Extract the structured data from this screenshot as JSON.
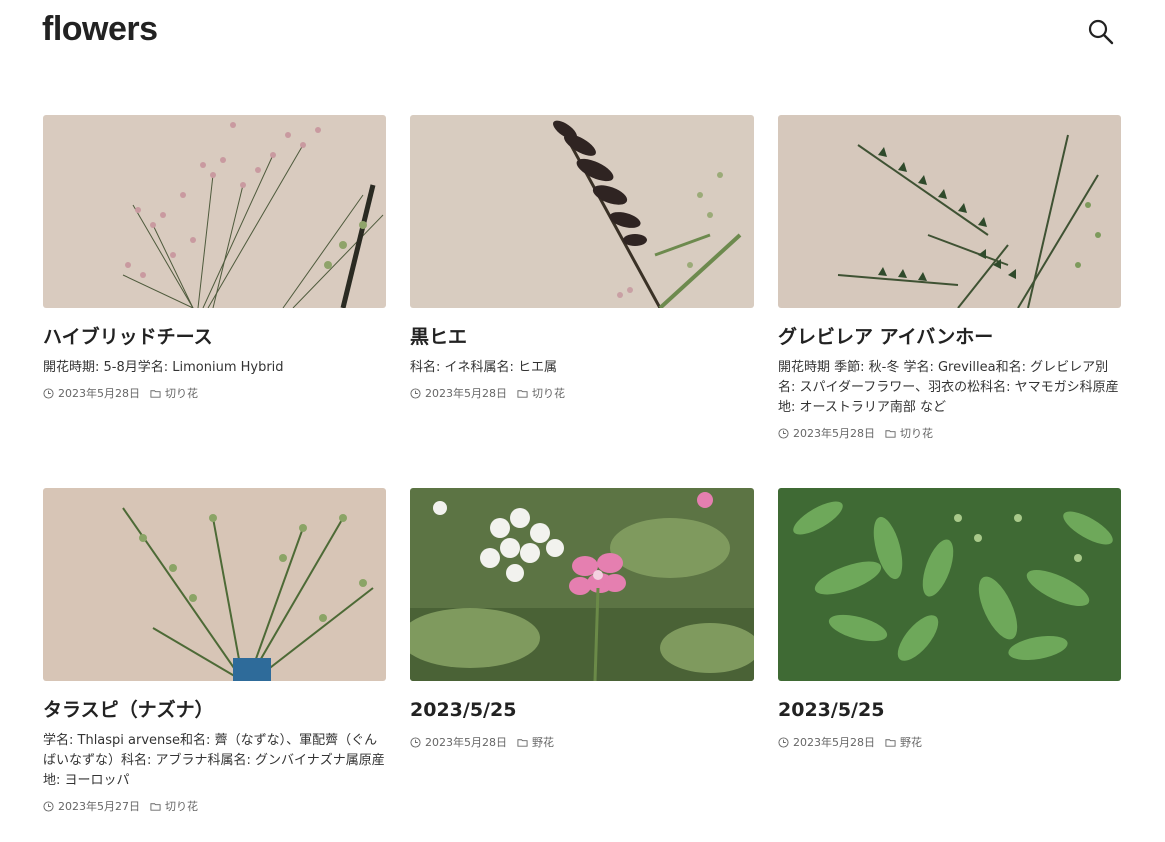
{
  "site": {
    "title": "flowers"
  },
  "posts": [
    {
      "title": "ハイブリッドチース",
      "excerpt": "開花時期: 5-8月学名: Limonium Hybrid",
      "date": "2023年5月28日",
      "category": "切り花"
    },
    {
      "title": "黒ヒエ",
      "excerpt": "科名: イネ科属名: ヒエ属",
      "date": "2023年5月28日",
      "category": "切り花"
    },
    {
      "title": "グレビレア アイバンホー",
      "excerpt": "開花時期 季節: 秋-冬 学名: Grevillea和名: グレビレア別名: スパイダーフラワー、羽衣の松科名: ヤマモガシ科原産地: オーストラリア南部 など",
      "date": "2023年5月28日",
      "category": "切り花"
    },
    {
      "title": "タラスピ（ナズナ）",
      "excerpt": "学名: Thlaspi arvense和名: 薺（なずな）、軍配薺（ぐんばいなずな）科名: アブラナ科属名: グンバイナズナ属原産地: ヨーロッパ",
      "date": "2023年5月27日",
      "category": "切り花"
    },
    {
      "title": "2023/5/25",
      "excerpt": "",
      "date": "2023年5月28日",
      "category": "野花"
    },
    {
      "title": "2023/5/25",
      "excerpt": "",
      "date": "2023年5月28日",
      "category": "野花"
    }
  ],
  "icons": {
    "search": "search-icon",
    "clock": "clock-icon",
    "folder": "folder-icon"
  }
}
